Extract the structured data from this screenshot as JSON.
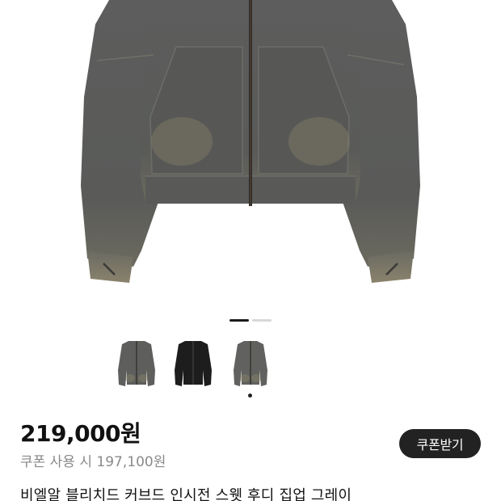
{
  "product": {
    "price": "219,000원",
    "coupon_price_text": "쿠폰 사용 시 197,100원",
    "coupon_button_label": "쿠폰받기",
    "title": "비엘알 블리치드 커브드 인시전 스웻 후디 집업 그레이"
  },
  "gallery": {
    "pager": {
      "count": 2,
      "active": 1
    },
    "thumbnails": [
      {
        "color": "grey-washed",
        "icon": "hoodie-icon"
      },
      {
        "color": "black",
        "icon": "hoodie-icon"
      },
      {
        "color": "grey-washed",
        "icon": "hoodie-icon",
        "selected": true
      }
    ]
  },
  "colors": {
    "hoodie_grey": "#5a5b5a",
    "hoodie_black": "#1d1d1d",
    "button_dark": "#222222",
    "muted_text": "#8a8a8a"
  }
}
